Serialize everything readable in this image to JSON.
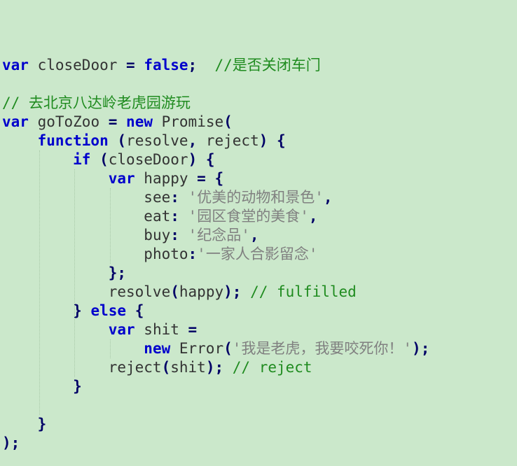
{
  "code_lines": [
    [],
    [
      {
        "t": "var",
        "c": "kw"
      },
      {
        "t": " closeDoor ",
        "c": "id"
      },
      {
        "t": "=",
        "c": "pn"
      },
      {
        "t": " ",
        "c": "id"
      },
      {
        "t": "false",
        "c": "kw"
      },
      {
        "t": ";",
        "c": "pn"
      },
      {
        "t": "  ",
        "c": "id"
      },
      {
        "t": "//是否关闭车门",
        "c": "cm"
      }
    ],
    [],
    [
      {
        "t": "// 去北京八达岭老虎园游玩",
        "c": "cm"
      }
    ],
    [
      {
        "t": "var",
        "c": "kw"
      },
      {
        "t": " goToZoo ",
        "c": "id"
      },
      {
        "t": "=",
        "c": "pn"
      },
      {
        "t": " ",
        "c": "id"
      },
      {
        "t": "new",
        "c": "kw"
      },
      {
        "t": " Promise",
        "c": "id"
      },
      {
        "t": "(",
        "c": "pn"
      }
    ],
    [
      {
        "t": "    ",
        "c": "id"
      },
      {
        "t": "function",
        "c": "kw"
      },
      {
        "t": " ",
        "c": "id"
      },
      {
        "t": "(",
        "c": "pn"
      },
      {
        "t": "resolve",
        "c": "id"
      },
      {
        "t": ",",
        "c": "pn"
      },
      {
        "t": " reject",
        "c": "id"
      },
      {
        "t": ")",
        "c": "pn"
      },
      {
        "t": " ",
        "c": "id"
      },
      {
        "t": "{",
        "c": "pn"
      }
    ],
    [
      {
        "t": "        ",
        "c": "id"
      },
      {
        "t": "if",
        "c": "kw"
      },
      {
        "t": " ",
        "c": "id"
      },
      {
        "t": "(",
        "c": "pn"
      },
      {
        "t": "closeDoor",
        "c": "id"
      },
      {
        "t": ")",
        "c": "pn"
      },
      {
        "t": " ",
        "c": "id"
      },
      {
        "t": "{",
        "c": "pn"
      }
    ],
    [
      {
        "t": "            ",
        "c": "id"
      },
      {
        "t": "var",
        "c": "kw"
      },
      {
        "t": " happy ",
        "c": "id"
      },
      {
        "t": "=",
        "c": "pn"
      },
      {
        "t": " ",
        "c": "id"
      },
      {
        "t": "{",
        "c": "pn"
      }
    ],
    [
      {
        "t": "                ",
        "c": "id"
      },
      {
        "t": "see",
        "c": "id"
      },
      {
        "t": ":",
        "c": "pn"
      },
      {
        "t": " ",
        "c": "id"
      },
      {
        "t": "'优美的动物和景色'",
        "c": "st"
      },
      {
        "t": ",",
        "c": "pn"
      }
    ],
    [
      {
        "t": "                ",
        "c": "id"
      },
      {
        "t": "eat",
        "c": "id"
      },
      {
        "t": ":",
        "c": "pn"
      },
      {
        "t": " ",
        "c": "id"
      },
      {
        "t": "'园区食堂的美食'",
        "c": "st"
      },
      {
        "t": ",",
        "c": "pn"
      }
    ],
    [
      {
        "t": "                ",
        "c": "id"
      },
      {
        "t": "buy",
        "c": "id"
      },
      {
        "t": ":",
        "c": "pn"
      },
      {
        "t": " ",
        "c": "id"
      },
      {
        "t": "'纪念品'",
        "c": "st"
      },
      {
        "t": ",",
        "c": "pn"
      }
    ],
    [
      {
        "t": "                ",
        "c": "id"
      },
      {
        "t": "photo",
        "c": "id"
      },
      {
        "t": ":",
        "c": "pn"
      },
      {
        "t": "'一家人合影留念'",
        "c": "st"
      }
    ],
    [
      {
        "t": "            ",
        "c": "id"
      },
      {
        "t": "}",
        "c": "pn"
      },
      {
        "t": ";",
        "c": "pn"
      }
    ],
    [
      {
        "t": "            ",
        "c": "id"
      },
      {
        "t": "resolve",
        "c": "id"
      },
      {
        "t": "(",
        "c": "pn"
      },
      {
        "t": "happy",
        "c": "id"
      },
      {
        "t": ")",
        "c": "pn"
      },
      {
        "t": ";",
        "c": "pn"
      },
      {
        "t": " ",
        "c": "id"
      },
      {
        "t": "// fulfilled",
        "c": "cm"
      }
    ],
    [
      {
        "t": "        ",
        "c": "id"
      },
      {
        "t": "}",
        "c": "pn"
      },
      {
        "t": " ",
        "c": "id"
      },
      {
        "t": "else",
        "c": "kw"
      },
      {
        "t": " ",
        "c": "id"
      },
      {
        "t": "{",
        "c": "pn"
      }
    ],
    [
      {
        "t": "            ",
        "c": "id"
      },
      {
        "t": "var",
        "c": "kw"
      },
      {
        "t": " shit ",
        "c": "id"
      },
      {
        "t": "=",
        "c": "pn"
      }
    ],
    [
      {
        "t": "                ",
        "c": "id"
      },
      {
        "t": "new",
        "c": "kw"
      },
      {
        "t": " Error",
        "c": "id"
      },
      {
        "t": "(",
        "c": "pn"
      },
      {
        "t": "'我是老虎，我要咬死你！'",
        "c": "st"
      },
      {
        "t": ")",
        "c": "pn"
      },
      {
        "t": ";",
        "c": "pn"
      }
    ],
    [
      {
        "t": "            ",
        "c": "id"
      },
      {
        "t": "reject",
        "c": "id"
      },
      {
        "t": "(",
        "c": "pn"
      },
      {
        "t": "shit",
        "c": "id"
      },
      {
        "t": ")",
        "c": "pn"
      },
      {
        "t": ";",
        "c": "pn"
      },
      {
        "t": " ",
        "c": "id"
      },
      {
        "t": "// reject",
        "c": "cm"
      }
    ],
    [
      {
        "t": "        ",
        "c": "id"
      },
      {
        "t": "}",
        "c": "pn"
      }
    ],
    [],
    [
      {
        "t": "    ",
        "c": "id"
      },
      {
        "t": "}",
        "c": "pn"
      }
    ],
    [
      {
        "t": ")",
        "c": "pn"
      },
      {
        "t": ";",
        "c": "pn"
      }
    ]
  ]
}
